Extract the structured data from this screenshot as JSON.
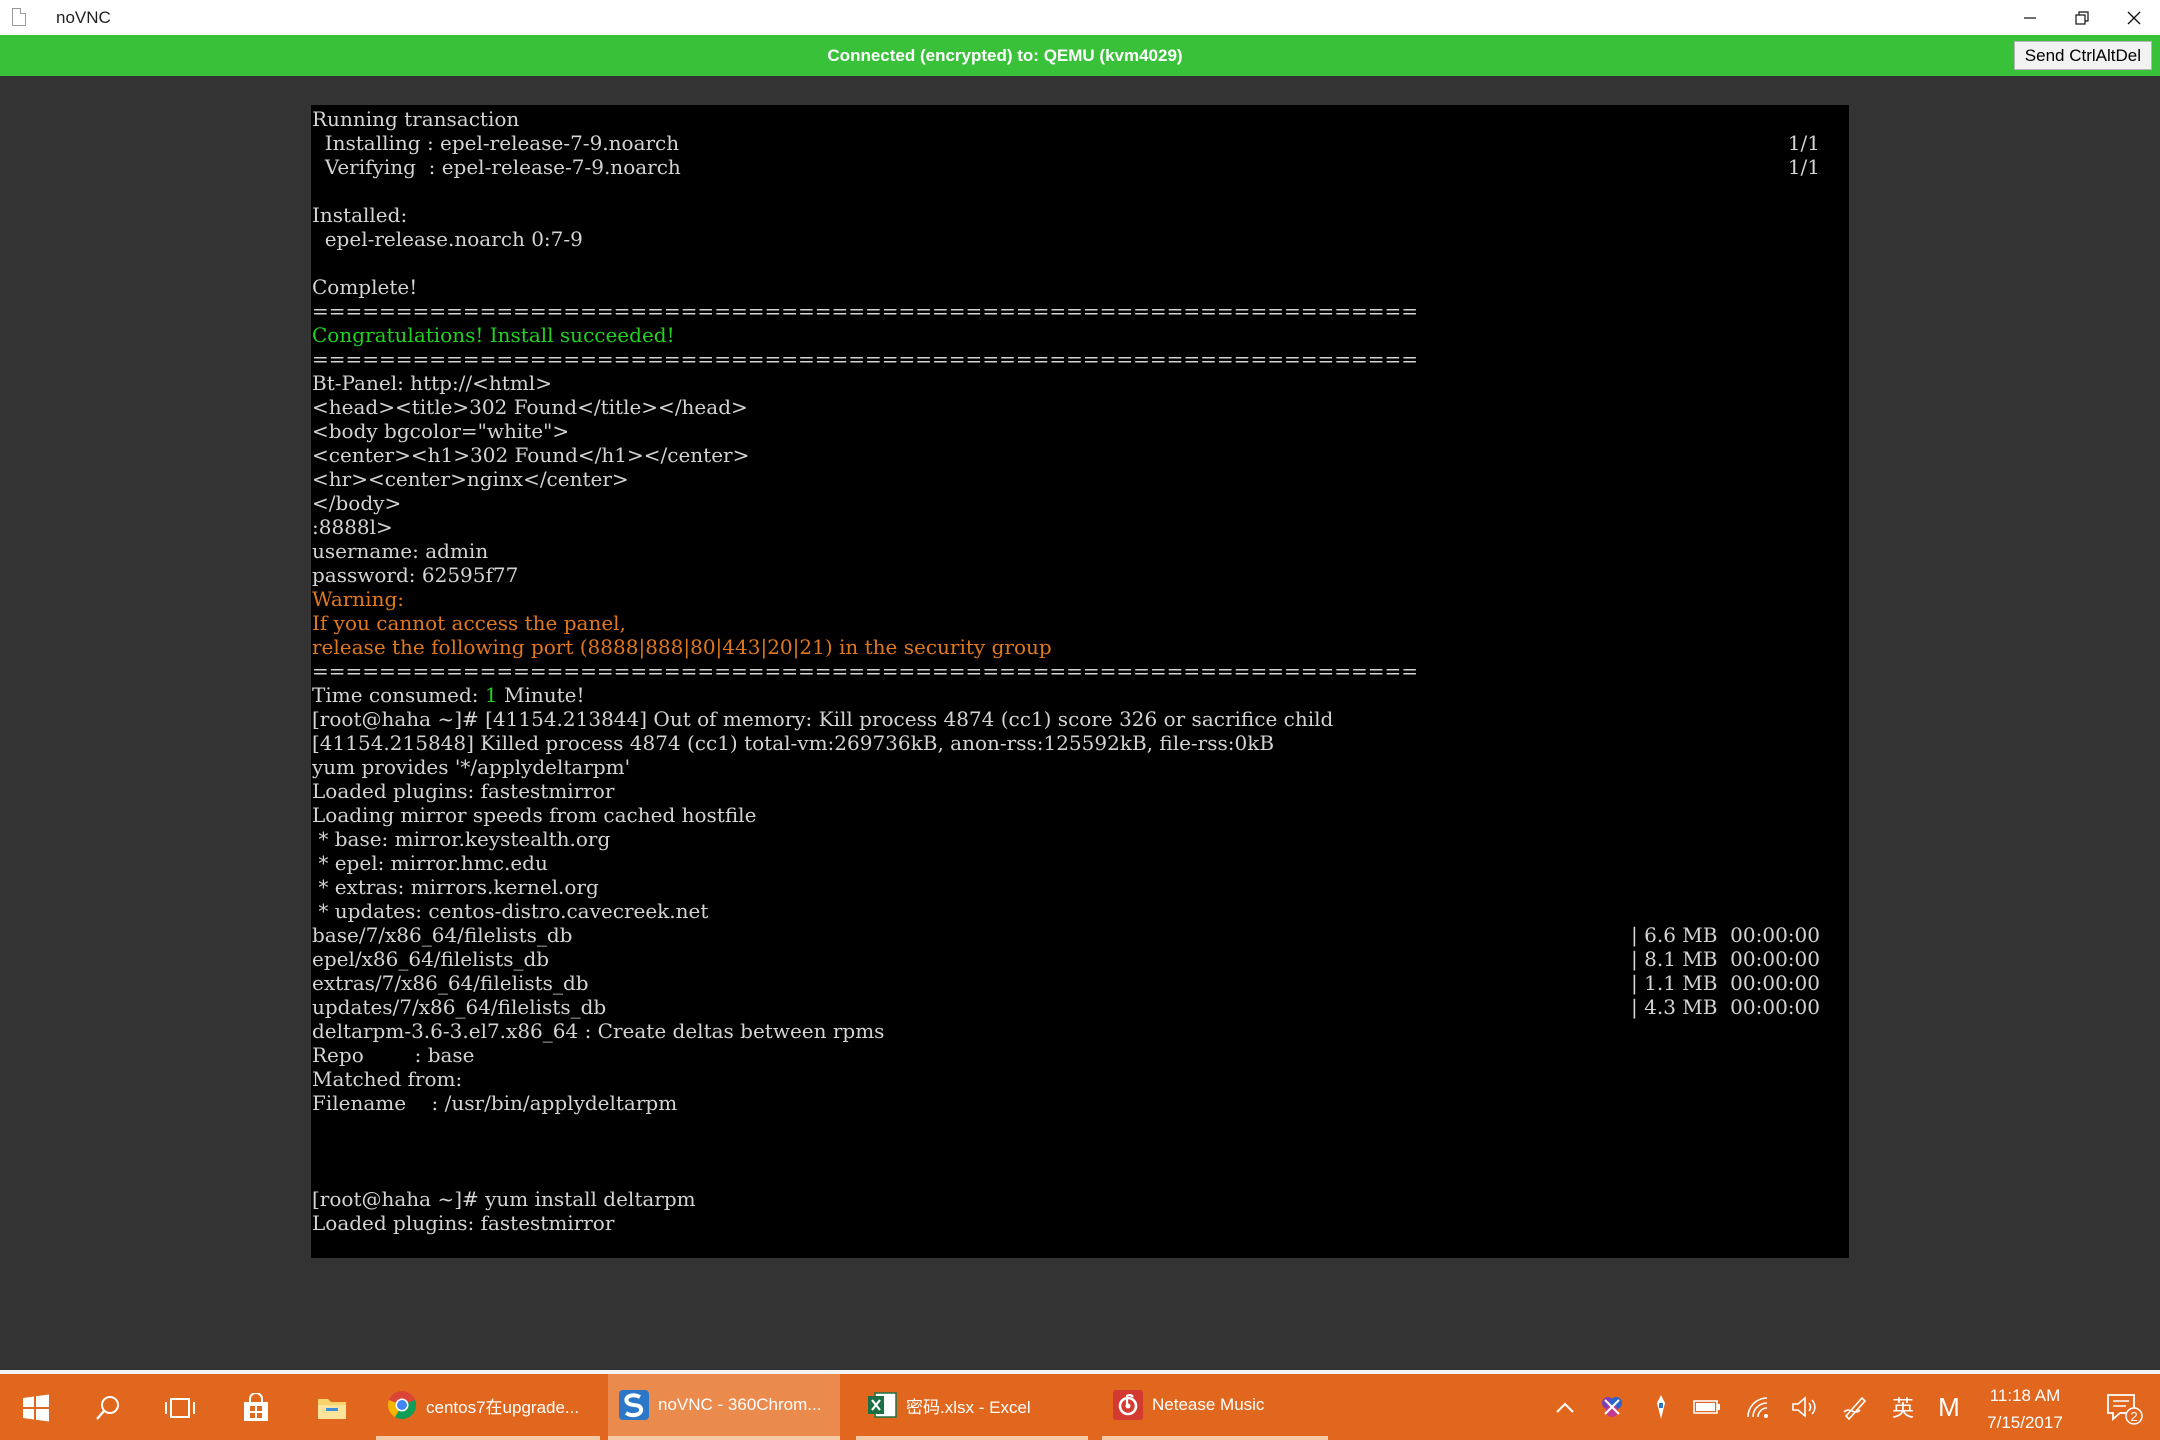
{
  "window": {
    "title": "noVNC",
    "icon": "document-icon"
  },
  "status_bar": {
    "text": "Connected (encrypted) to: QEMU (kvm4029)",
    "color": "#39c239",
    "send_ctrl_alt_del_label": "Send CtrlAltDel"
  },
  "terminal": {
    "lines": [
      [
        {
          "t": "Running transaction",
          "c": "white"
        }
      ],
      [
        {
          "t": "  Installing : epel-release-7-9.noarch",
          "c": "white"
        }
      ],
      [
        {
          "t": "  Verifying  : epel-release-7-9.noarch",
          "c": "white"
        }
      ],
      [],
      [
        {
          "t": "Installed:",
          "c": "white"
        }
      ],
      [
        {
          "t": "  epel-release.noarch 0:7-9",
          "c": "white"
        }
      ],
      [],
      [
        {
          "t": "Complete!",
          "c": "white"
        }
      ],
      [
        {
          "t": "==================================================================",
          "c": "white"
        }
      ],
      [
        {
          "t": "Congratulations! Install succeeded!",
          "c": "green"
        }
      ],
      [
        {
          "t": "==================================================================",
          "c": "white"
        }
      ],
      [
        {
          "t": "Bt-Panel: http://<html>",
          "c": "white"
        }
      ],
      [
        {
          "t": "<head><title>302 Found</title></head>",
          "c": "white"
        }
      ],
      [
        {
          "t": "<body bgcolor=\"white\">",
          "c": "white"
        }
      ],
      [
        {
          "t": "<center><h1>302 Found</h1></center>",
          "c": "white"
        }
      ],
      [
        {
          "t": "<hr><center>nginx</center>",
          "c": "white"
        }
      ],
      [
        {
          "t": "</body>",
          "c": "white"
        }
      ],
      [
        {
          "t": ":8888l>",
          "c": "white"
        }
      ],
      [
        {
          "t": "username: admin",
          "c": "white"
        }
      ],
      [
        {
          "t": "password: 62595f77",
          "c": "white"
        }
      ],
      [
        {
          "t": "Warning:",
          "c": "orange"
        }
      ],
      [
        {
          "t": "If you cannot access the panel,",
          "c": "orange"
        }
      ],
      [
        {
          "t": "release the following port (8888|888|80|443|20|21) in the security group",
          "c": "orange"
        }
      ],
      [
        {
          "t": "==================================================================",
          "c": "white"
        }
      ],
      [
        {
          "t": "Time consumed: ",
          "c": "white"
        },
        {
          "t": "1",
          "c": "green"
        },
        {
          "t": " Minute!",
          "c": "white"
        }
      ],
      [
        {
          "t": "[root@haha ~]# [41154.213844] Out of memory: Kill process 4874 (cc1) score 326 or sacrifice child",
          "c": "white"
        }
      ],
      [
        {
          "t": "[41154.215848] Killed process 4874 (cc1) total-vm:269736kB, anon-rss:125592kB, file-rss:0kB",
          "c": "white"
        }
      ],
      [
        {
          "t": "yum provides '*/applydeltarpm'",
          "c": "white"
        }
      ],
      [
        {
          "t": "Loaded plugins: fastestmirror",
          "c": "white"
        }
      ],
      [
        {
          "t": "Loading mirror speeds from cached hostfile",
          "c": "white"
        }
      ],
      [
        {
          "t": " * base: mirror.keystealth.org",
          "c": "white"
        }
      ],
      [
        {
          "t": " * epel: mirror.hmc.edu",
          "c": "white"
        }
      ],
      [
        {
          "t": " * extras: mirrors.kernel.org",
          "c": "white"
        }
      ],
      [
        {
          "t": " * updates: centos-distro.cavecreek.net",
          "c": "white"
        }
      ],
      [
        {
          "t": "base/7/x86_64/filelists_db",
          "c": "white"
        }
      ],
      [
        {
          "t": "epel/x86_64/filelists_db",
          "c": "white"
        }
      ],
      [
        {
          "t": "extras/7/x86_64/filelists_db",
          "c": "white"
        }
      ],
      [
        {
          "t": "updates/7/x86_64/filelists_db",
          "c": "white"
        }
      ],
      [
        {
          "t": "deltarpm-3.6-3.el7.x86_64 : Create deltas between rpms",
          "c": "white"
        }
      ],
      [
        {
          "t": "Repo        : base",
          "c": "white"
        }
      ],
      [
        {
          "t": "Matched from:",
          "c": "white"
        }
      ],
      [
        {
          "t": "Filename    : /usr/bin/applydeltarpm",
          "c": "white"
        }
      ],
      [],
      [],
      [],
      [
        {
          "t": "[root@haha ~]# yum install deltarpm",
          "c": "white"
        }
      ],
      [
        {
          "t": "Loaded plugins: fastestmirror",
          "c": "white"
        }
      ]
    ],
    "right_column": [
      {
        "row": 1,
        "text": "1/1"
      },
      {
        "row": 2,
        "text": "1/1"
      },
      {
        "row": 34,
        "text": "| 6.6 MB  00:00:00"
      },
      {
        "row": 35,
        "text": "| 8.1 MB  00:00:00"
      },
      {
        "row": 36,
        "text": "| 1.1 MB  00:00:00"
      },
      {
        "row": 37,
        "text": "| 4.3 MB  00:00:00"
      }
    ],
    "colors": {
      "white": "#d4d4d4",
      "green": "#1fd31f",
      "orange": "#e0781c",
      "background": "#000000"
    }
  },
  "taskbar": {
    "color": "#e1671e",
    "tasks": [
      {
        "label": "centos7在upgrade...",
        "icon": "chrome-icon"
      },
      {
        "label": "noVNC - 360Chrom...",
        "icon": "360chrome-icon"
      },
      {
        "label": "密码.xlsx - Excel",
        "icon": "excel-icon"
      },
      {
        "label": "Netease Music",
        "icon": "netease-music-icon"
      }
    ],
    "tray": {
      "ime": "英",
      "ime2": "M"
    },
    "clock": {
      "time": "11:18 AM",
      "date": "7/15/2017"
    },
    "notification_count": "2"
  }
}
